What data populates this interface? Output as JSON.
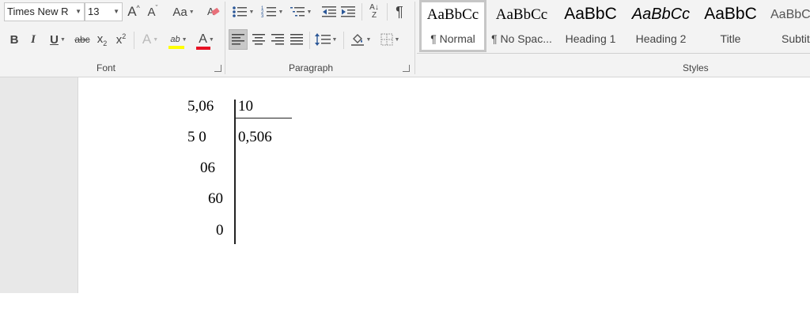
{
  "ribbon": {
    "font": {
      "font_name": "Times New R",
      "font_size": "13",
      "grow_icon": "A",
      "shrink_icon": "A",
      "change_case": "Aa",
      "bold": "B",
      "italic": "I",
      "underline": "U",
      "strikethrough": "abc",
      "subscript_base": "x",
      "subscript_mark": "2",
      "superscript_base": "x",
      "superscript_mark": "2",
      "text_effects": "A",
      "highlight": "ab",
      "font_color": "A",
      "group_label": "Font"
    },
    "paragraph": {
      "sort_icon": "A↓Z",
      "show_marks": "¶",
      "group_label": "Paragraph"
    },
    "styles": {
      "tiles": [
        {
          "preview": "AaBbCc",
          "name": "¶ Normal"
        },
        {
          "preview": "AaBbCc",
          "name": "¶ No Spac..."
        },
        {
          "preview": "AaBbC",
          "name": "Heading 1"
        },
        {
          "preview": "AaBbCc",
          "name": "Heading 2"
        },
        {
          "preview": "AaBbC",
          "name": "Title"
        },
        {
          "preview": "AaBbC",
          "name": "Subtit"
        }
      ],
      "group_label": "Styles"
    },
    "colors": {
      "highlight": "#ffff00",
      "font_color": "#e81123"
    }
  },
  "document": {
    "dividend": "5,06",
    "divisor": "10",
    "step1": "5 0",
    "quotient": "0,506",
    "step2": "06",
    "step3": "60",
    "remainder": "0"
  }
}
